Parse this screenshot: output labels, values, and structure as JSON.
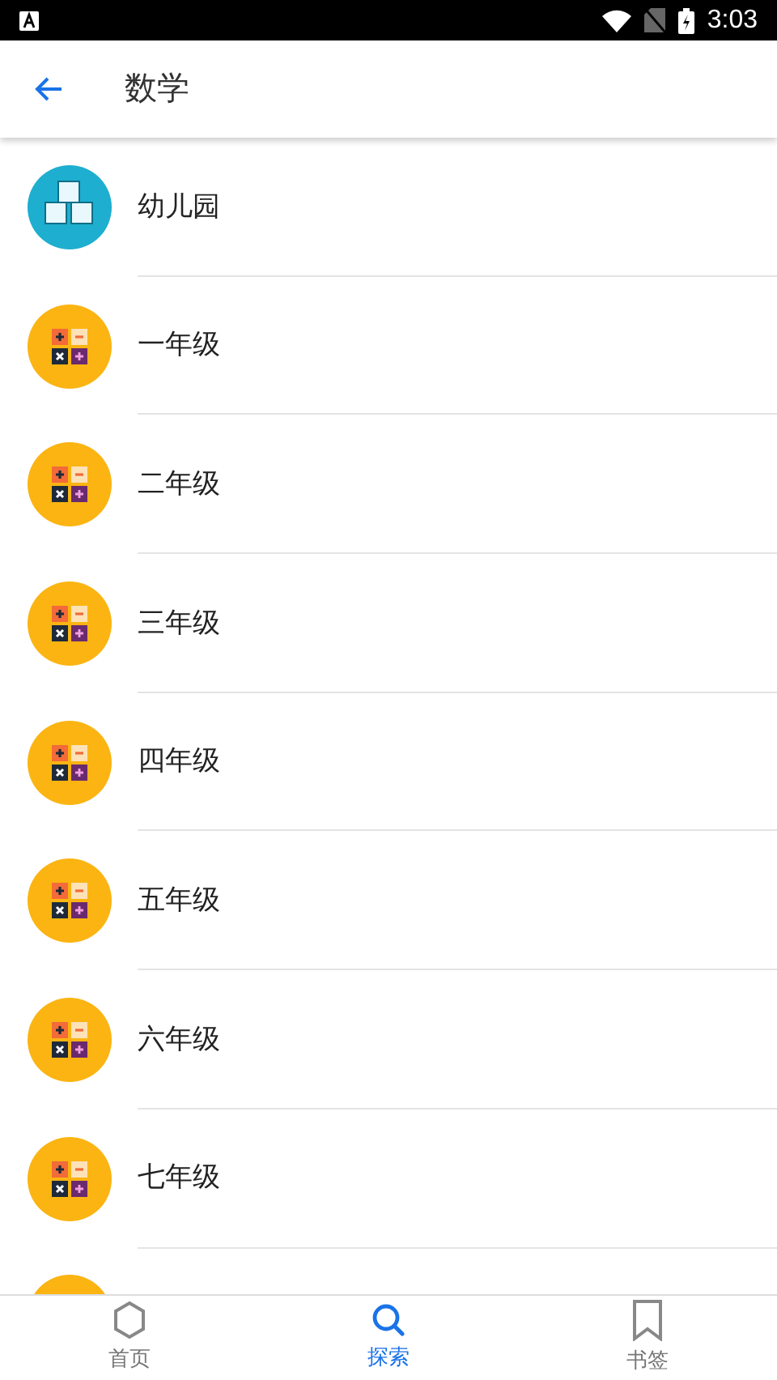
{
  "status_bar": {
    "time": "3:03"
  },
  "app_bar": {
    "title": "数学"
  },
  "list": [
    {
      "kind": "blocks",
      "label": "幼儿园"
    },
    {
      "kind": "calc",
      "label": "一年级"
    },
    {
      "kind": "calc",
      "label": "二年级"
    },
    {
      "kind": "calc",
      "label": "三年级"
    },
    {
      "kind": "calc",
      "label": "四年级"
    },
    {
      "kind": "calc",
      "label": "五年级"
    },
    {
      "kind": "calc",
      "label": "六年级"
    },
    {
      "kind": "calc",
      "label": "七年级"
    },
    {
      "kind": "calc"
    }
  ],
  "bottom_nav": [
    {
      "kind": "home",
      "label": "首页",
      "selected": false
    },
    {
      "kind": "search",
      "label": "探索",
      "selected": true
    },
    {
      "kind": "bookmark",
      "label": "书签",
      "selected": false
    }
  ]
}
